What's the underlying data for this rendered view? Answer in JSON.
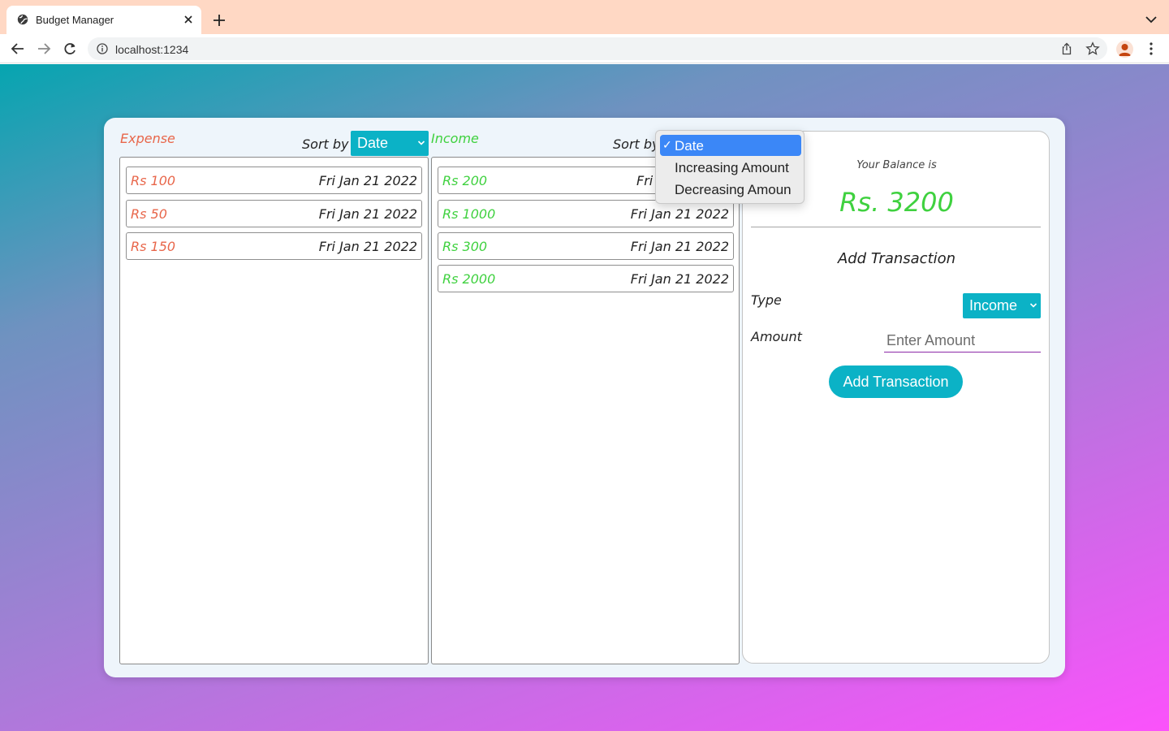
{
  "browser": {
    "tab_title": "Budget Manager",
    "url": "localhost:1234"
  },
  "expense": {
    "title": "Expense",
    "sort_label": "Sort by",
    "sort_value": "Date",
    "items": [
      {
        "amount": "Rs 100",
        "date": "Fri Jan 21 2022"
      },
      {
        "amount": "Rs 50",
        "date": "Fri Jan 21 2022"
      },
      {
        "amount": "Rs 150",
        "date": "Fri Jan 21 2022"
      }
    ]
  },
  "income": {
    "title": "Income",
    "sort_label": "Sort by",
    "items": [
      {
        "amount": "Rs 200",
        "date": "Fri"
      },
      {
        "amount": "Rs 1000",
        "date": "Fri Jan 21 2022"
      },
      {
        "amount": "Rs 300",
        "date": "Fri Jan 21 2022"
      },
      {
        "amount": "Rs 2000",
        "date": "Fri Jan 21 2022"
      }
    ]
  },
  "sort_dropdown": {
    "check": "✓",
    "options": [
      "Date",
      "Increasing Amount",
      "Decreasing Amoun"
    ],
    "selected": "Date"
  },
  "balance": {
    "label": "Your Balance is",
    "value": "Rs. 3200"
  },
  "add_form": {
    "title": "Add Transaction",
    "type_label": "Type",
    "type_value": "Income",
    "amount_label": "Amount",
    "amount_placeholder": "Enter Amount",
    "submit_label": "Add Transaction"
  },
  "colors": {
    "expense": "#e8664a",
    "income": "#3fd13f",
    "accent": "#0bb2c6",
    "dropdown_highlight": "#3b87f7"
  }
}
